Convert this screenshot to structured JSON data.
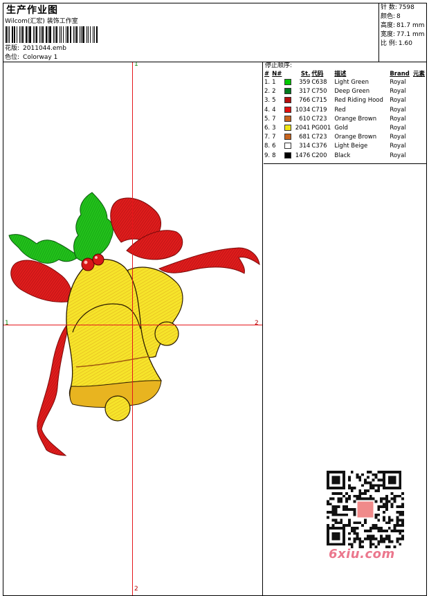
{
  "header": {
    "title": "生产作业图",
    "company": "Wilcom(汇宏) 装饰工作室",
    "design_label": "花版:",
    "design_file": "2011044.emb",
    "colorway_label": "色位:",
    "colorway": "Colorway 1"
  },
  "stats": [
    {
      "label": "针 数:",
      "value": "7598"
    },
    {
      "label": "颜色:",
      "value": "8"
    },
    {
      "label": "高度:",
      "value": "81.7 mm"
    },
    {
      "label": "宽度:",
      "value": "77.1 mm"
    },
    {
      "label": "比 例:",
      "value": "1.60"
    }
  ],
  "axis_marks": {
    "top": "1",
    "bottom": "2",
    "left": "1",
    "right": "2"
  },
  "stop_sequence": {
    "title": "停止顺序:",
    "headers": {
      "idx": "#",
      "no": "N#",
      "stitches": "St.",
      "code": "代码",
      "desc": "描述",
      "brand": "Brand",
      "elem": "元素"
    },
    "rows": [
      {
        "idx": "1.",
        "no": "1",
        "color": "#00c800",
        "stitches": "359",
        "code": "C638",
        "desc": "Light Green",
        "brand": "Royal"
      },
      {
        "idx": "2.",
        "no": "2",
        "color": "#007a1e",
        "stitches": "317",
        "code": "C750",
        "desc": "Deep Green",
        "brand": "Royal"
      },
      {
        "idx": "3.",
        "no": "5",
        "color": "#b40f0f",
        "stitches": "766",
        "code": "C715",
        "desc": "Red Riding Hood",
        "brand": "Royal"
      },
      {
        "idx": "4.",
        "no": "4",
        "color": "#e01010",
        "stitches": "1034",
        "code": "C719",
        "desc": "Red",
        "brand": "Royal"
      },
      {
        "idx": "5.",
        "no": "7",
        "color": "#c8641e",
        "stitches": "610",
        "code": "C723",
        "desc": "Orange Brown",
        "brand": "Royal"
      },
      {
        "idx": "6.",
        "no": "3",
        "color": "#f0e614",
        "stitches": "2041",
        "code": "PG001",
        "desc": "Gold",
        "brand": "Royal"
      },
      {
        "idx": "7.",
        "no": "7",
        "color": "#c8641e",
        "stitches": "681",
        "code": "C723",
        "desc": "Orange Brown",
        "brand": "Royal"
      },
      {
        "idx": "8.",
        "no": "6",
        "color": "#ffffff",
        "stitches": "314",
        "code": "C376",
        "desc": "Light Beige",
        "brand": "Royal"
      },
      {
        "idx": "9.",
        "no": "8",
        "color": "#000000",
        "stitches": "1476",
        "code": "C200",
        "desc": "Black",
        "brand": "Royal"
      }
    ]
  },
  "watermark": "6xiu.com",
  "artwork": {
    "subject": "Christmas bells with holly and red ribbon embroidery",
    "icon": "embroidery-preview-image"
  }
}
